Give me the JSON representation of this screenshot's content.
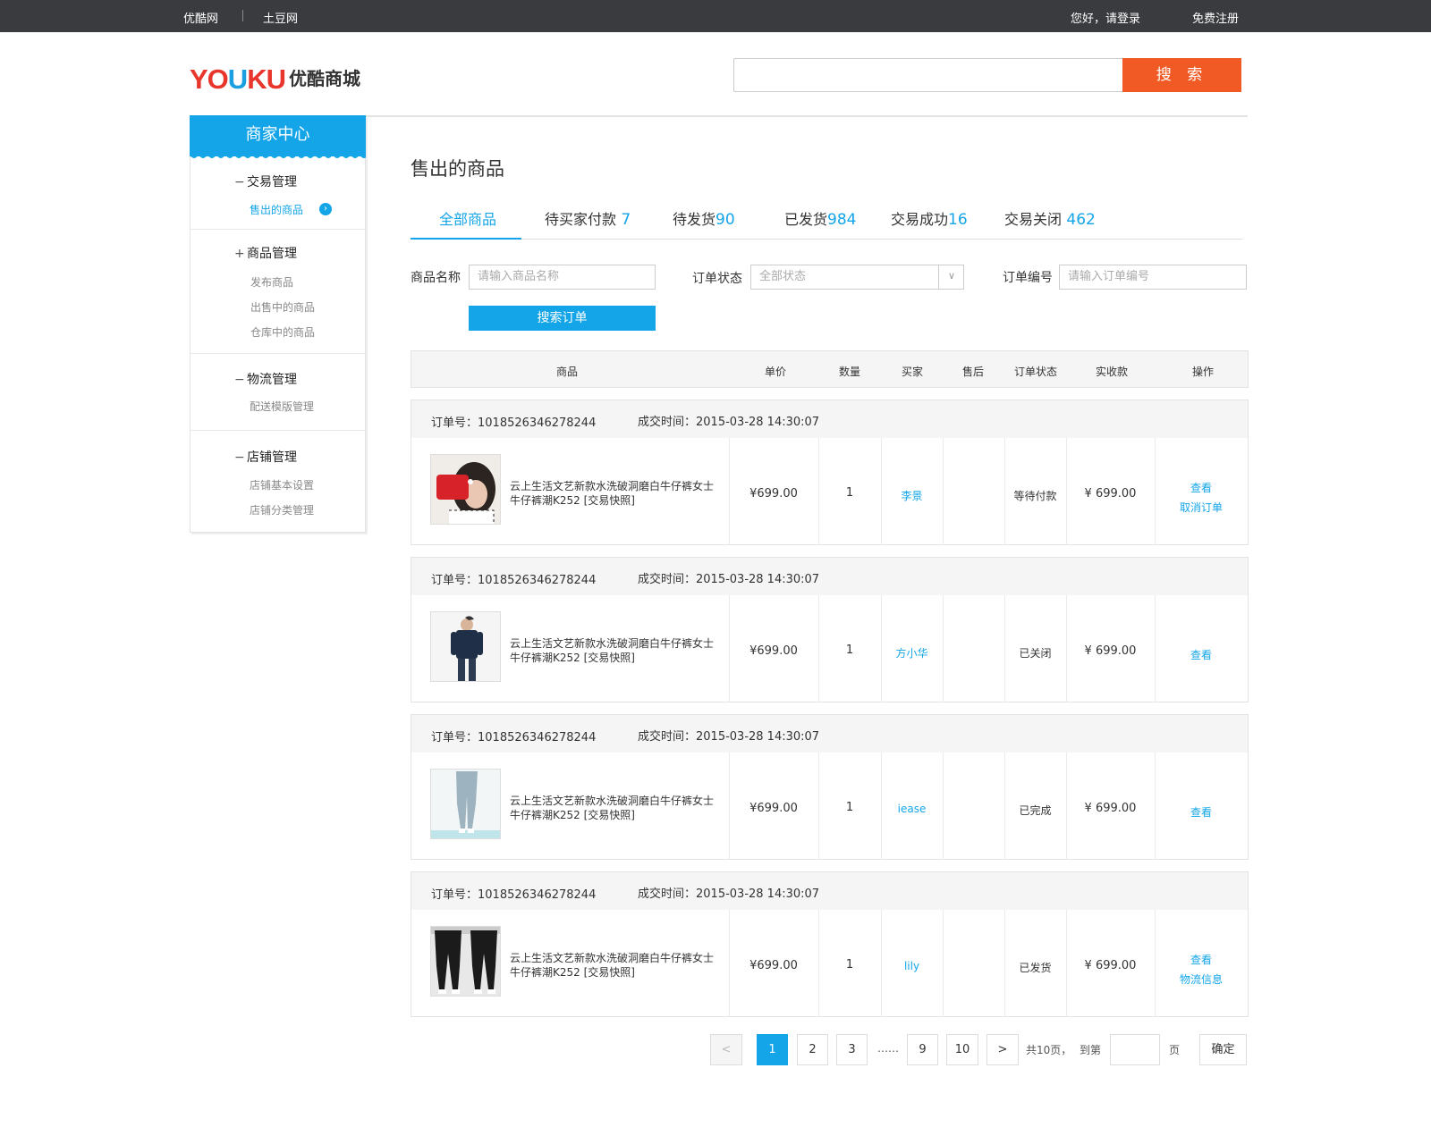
{
  "topbar": {
    "site1": "优酷网",
    "site2": "土豆网",
    "login": "您好，请登录",
    "register": "免费注册"
  },
  "logo": {
    "yk_red": "YO",
    "yk_blue": "U",
    "yk_red2": "KU",
    "mall": "优酷商城"
  },
  "search": {
    "button": "搜 索",
    "placeholder": ""
  },
  "sidebar": {
    "title": "商家中心",
    "groups": [
      {
        "sym": "−",
        "title": "交易管理",
        "items": [
          "售出的商品"
        ]
      },
      {
        "sym": "+",
        "title": "商品管理",
        "items": [
          "发布商品",
          "出售中的商品",
          "仓库中的商品"
        ]
      },
      {
        "sym": "−",
        "title": "物流管理",
        "items": [
          "配送模版管理"
        ]
      },
      {
        "sym": "−",
        "title": "店铺管理",
        "items": [
          "店铺基本设置",
          "店铺分类管理"
        ]
      }
    ]
  },
  "page_title": "售出的商品",
  "tabs": [
    {
      "label": "全部商品",
      "count": ""
    },
    {
      "label": "待买家付款",
      "count": " 7"
    },
    {
      "label": "待发货",
      "count": "90"
    },
    {
      "label": "已发货",
      "count": "984"
    },
    {
      "label": "交易成功",
      "count": "16"
    },
    {
      "label": "交易关闭",
      "count": " 462"
    }
  ],
  "filters": {
    "name_label": "商品名称",
    "name_placeholder": "请输入商品名称",
    "status_label": "订单状态",
    "status_value": "全部状态",
    "no_label": "订单编号",
    "no_placeholder": "请输入订单编号",
    "search_button": "搜索订单"
  },
  "table_headers": [
    "商品",
    "单价",
    "数量",
    "买家",
    "售后",
    "订单状态",
    "实收款",
    "操作"
  ],
  "orders": [
    {
      "order_no": "订单号：1018526346278244",
      "time": "成交时间：2015-03-28  14:30:07",
      "product": "云上生活文艺新款水洗破洞磨白牛仔裤女士牛仔裤潮K252 [交易快照]",
      "price": "¥699.00",
      "qty": "1",
      "buyer": "李景",
      "after_sale": "",
      "status": "等待付款",
      "paid": "¥ 699.00",
      "ops": [
        "查看",
        "取消订单"
      ]
    },
    {
      "order_no": "订单号：1018526346278244",
      "time": "成交时间：2015-03-28  14:30:07",
      "product": "云上生活文艺新款水洗破洞磨白牛仔裤女士牛仔裤潮K252 [交易快照]",
      "price": "¥699.00",
      "qty": "1",
      "buyer": "方小华",
      "after_sale": "",
      "status": "已关闭",
      "paid": "¥ 699.00",
      "ops": [
        "查看"
      ]
    },
    {
      "order_no": "订单号：1018526346278244",
      "time": "成交时间：2015-03-28  14:30:07",
      "product": "云上生活文艺新款水洗破洞磨白牛仔裤女士牛仔裤潮K252 [交易快照]",
      "price": "¥699.00",
      "qty": "1",
      "buyer": "iease",
      "after_sale": "",
      "status": "已完成",
      "paid": "¥ 699.00",
      "ops": [
        "查看"
      ]
    },
    {
      "order_no": "订单号：1018526346278244",
      "time": "成交时间：2015-03-28  14:30:07",
      "product": "云上生活文艺新款水洗破洞磨白牛仔裤女士牛仔裤潮K252 [交易快照]",
      "price": "¥699.00",
      "qty": "1",
      "buyer": "lily",
      "after_sale": "",
      "status": "已发货",
      "paid": "¥ 699.00",
      "ops": [
        "查看",
        "物流信息"
      ]
    }
  ],
  "pagination": {
    "prev": "<",
    "pages": [
      "1",
      "2",
      "3"
    ],
    "ellipsis": "……",
    "pages2": [
      "9",
      "10"
    ],
    "next": ">",
    "total": "共10页，",
    "goto": "到第",
    "page_unit": "页",
    "confirm": "确定",
    "current": "1"
  },
  "colors": {
    "accent": "#13a5e8",
    "search_button": "#f15a24",
    "topbar": "#3a3b3f"
  }
}
